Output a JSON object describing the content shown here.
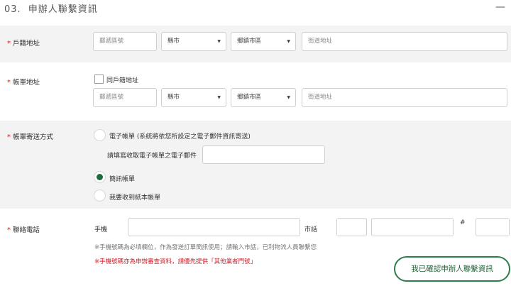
{
  "section": {
    "number": "03.",
    "title": "申辦人聯繫資訊",
    "collapse_icon": "minus-icon"
  },
  "registered_address": {
    "label": "戶籍地址",
    "required_mark": "*",
    "postal_placeholder": "郵遞區號",
    "county": "縣市",
    "district": "鄉鎮市區",
    "street_placeholder": "街道地址"
  },
  "billing_address": {
    "label": "帳單地址",
    "required_mark": "*",
    "same_as_registered": "同戶籍地址",
    "postal_placeholder": "郵遞區號",
    "county": "縣市",
    "district": "鄉鎮市區",
    "street_placeholder": "街道地址"
  },
  "bill_delivery": {
    "label": "帳單寄送方式",
    "required_mark": "*",
    "options": [
      {
        "label": "電子帳單 (系統將依您所設定之電子郵件資訊寄送)",
        "selected": false
      },
      {
        "label": "簡訊帳單",
        "selected": true
      },
      {
        "label": "我要收到紙本帳單",
        "selected": false
      }
    ],
    "email_prompt": "請填寫收取電子帳單之電子郵件",
    "email_value": ""
  },
  "phone": {
    "label": "聯絡電話",
    "required_mark": "*",
    "mobile_label": "手機",
    "mobile_value": "",
    "landline_label": "市話",
    "area_code_value": "",
    "landline_value": "",
    "extension_mark": "#",
    "extension_value": "",
    "note": "※手機號碼為必填欄位，作為發送訂單簡訊使用；請輸入市話，已利物流人員聯繫您",
    "warning": "※手機號碼亦為申辦審查資料，請優先提供「其他業者門號」"
  },
  "confirm_button": "我已確認申辦人聯繫資訊",
  "colors": {
    "accent": "#1e6b3a",
    "required": "#c0202a",
    "band": "#f3f3f3"
  }
}
